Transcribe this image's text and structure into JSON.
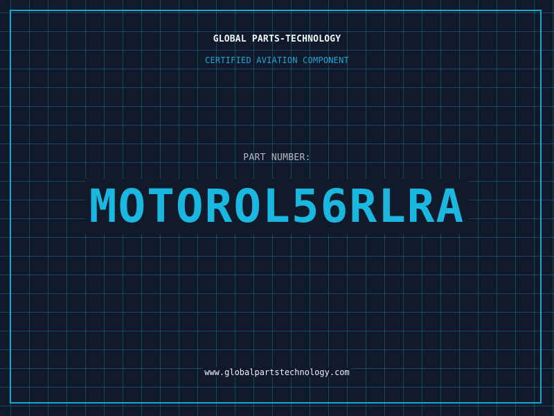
{
  "header": {
    "company": "GLOBAL PARTS-TECHNOLOGY",
    "subtitle": "CERTIFIED AVIATION COMPONENT"
  },
  "part": {
    "label": "PART NUMBER:",
    "number": "MOTOROL56RLRA"
  },
  "footer": {
    "website": "www.globalpartstechnology.com"
  },
  "colors": {
    "background": "#111a2b",
    "grid": "#1a6e8c",
    "accent": "#1ab8e0",
    "border": "#1aa9d2"
  }
}
